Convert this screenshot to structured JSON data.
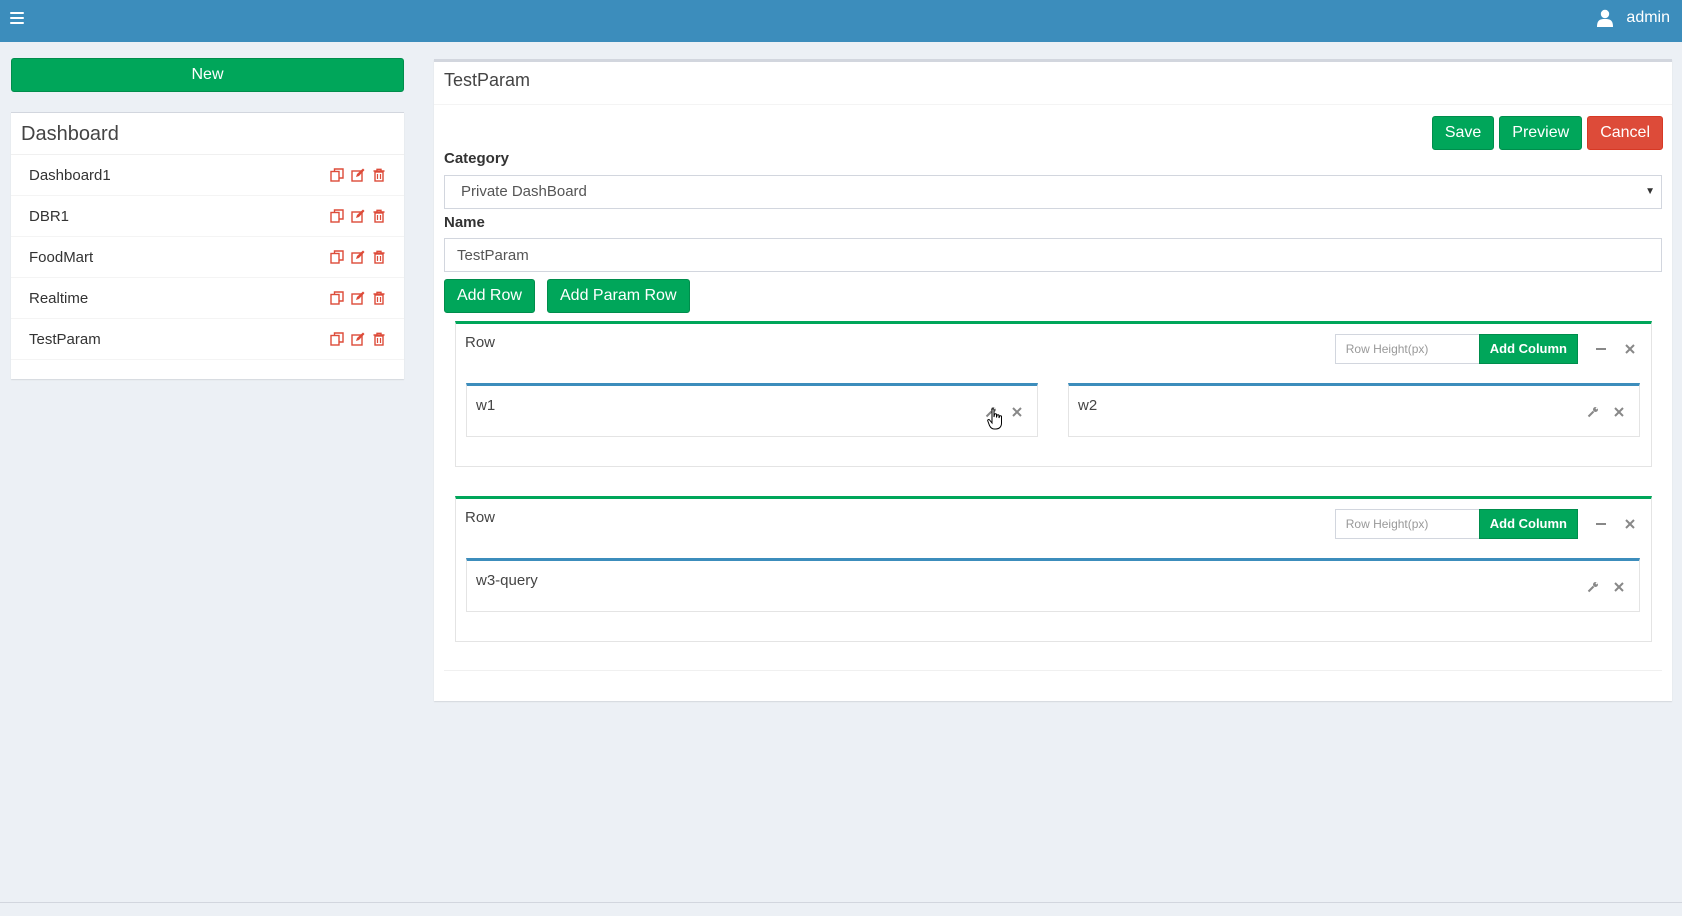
{
  "topbar": {
    "menu_icon": "hamburger-icon",
    "user_icon": "user-icon",
    "user_name": "admin",
    "color": "#3c8dbc"
  },
  "sidebar": {
    "new_button": "New",
    "title": "Dashboard",
    "items": [
      {
        "label": "Dashboard1"
      },
      {
        "label": "DBR1"
      },
      {
        "label": "FoodMart"
      },
      {
        "label": "Realtime"
      },
      {
        "label": "TestParam"
      }
    ],
    "item_icons": [
      "copy-icon",
      "edit-icon",
      "trash-icon"
    ],
    "icon_color": "#dd4b39"
  },
  "main": {
    "title": "TestParam",
    "buttons": {
      "save": "Save",
      "preview": "Preview",
      "cancel": "Cancel"
    },
    "category_label": "Category",
    "category_value": "Private DashBoard",
    "name_label": "Name",
    "name_value": "TestParam",
    "add_row": "Add Row",
    "add_param_row": "Add Param Row",
    "rows": [
      {
        "label": "Row",
        "height_placeholder": "Row Height(px)",
        "add_column": "Add Column",
        "widgets": [
          {
            "label": "w1"
          },
          {
            "label": "w2"
          }
        ]
      },
      {
        "label": "Row",
        "height_placeholder": "Row Height(px)",
        "add_column": "Add Column",
        "widgets": [
          {
            "label": "w3-query"
          }
        ]
      }
    ]
  },
  "colors": {
    "green": "#00a65a",
    "red": "#dd4b39",
    "blue": "#3c8dbc",
    "background": "#ecf0f5"
  }
}
